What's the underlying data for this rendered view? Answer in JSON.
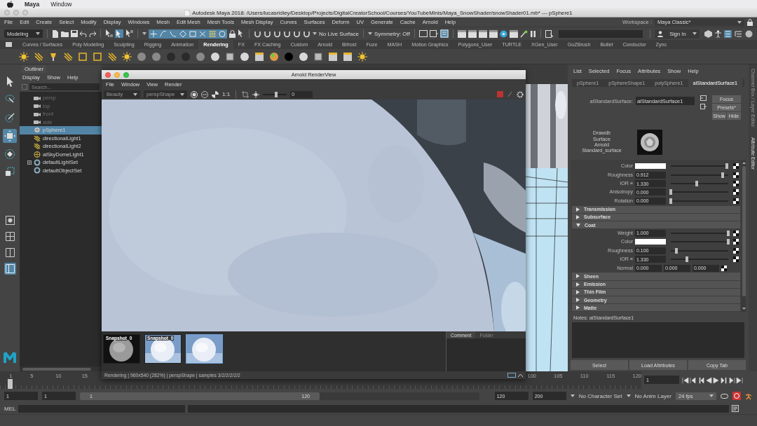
{
  "mac_menubar": {
    "app": "Maya",
    "items": [
      "Window"
    ]
  },
  "window": {
    "title": "Autodesk Maya 2018: /Users/lucasridley/Desktop/Projects/DigitalCreatorSchool/Courses/YouTubeMinis/Maya_SnowShader/snowShader01.mb*  ---  pSphere1"
  },
  "menu_bar": [
    "File",
    "Edit",
    "Create",
    "Select",
    "Modify",
    "Display",
    "Windows",
    "Mesh",
    "Edit Mesh",
    "Mesh Tools",
    "Mesh Display",
    "Curves",
    "Surfaces",
    "Deform",
    "UV",
    "Generate",
    "Cache",
    "Arnold",
    "Help"
  ],
  "workspace": {
    "label": "Workspace :",
    "value": "Maya Classic*"
  },
  "status_line": {
    "menu_set": "Modeling",
    "live_surface": "No Live Surface",
    "symmetry": "Symmetry: Off",
    "sign_in": "Sign In"
  },
  "shelf_tabs": [
    {
      "label": "Curves / Surfaces",
      "selected": false
    },
    {
      "label": "Poly Modeling",
      "selected": false
    },
    {
      "label": "Sculpting",
      "selected": false
    },
    {
      "label": "Rigging",
      "selected": false
    },
    {
      "label": "Animation",
      "selected": false
    },
    {
      "label": "Rendering",
      "selected": true
    },
    {
      "label": "FX",
      "selected": false
    },
    {
      "label": "FX Caching",
      "selected": false
    },
    {
      "label": "Custom",
      "selected": false
    },
    {
      "label": "Arnold",
      "selected": false
    },
    {
      "label": "Bifrost",
      "selected": false
    },
    {
      "label": "Fuze",
      "selected": false
    },
    {
      "label": "MASH",
      "selected": false
    },
    {
      "label": "Motion Graphics",
      "selected": false
    },
    {
      "label": "Polygons_User",
      "selected": false
    },
    {
      "label": "TURTLE",
      "selected": false
    },
    {
      "label": "XGen_User",
      "selected": false
    },
    {
      "label": "GoZBrush",
      "selected": false
    },
    {
      "label": "Bullet",
      "selected": false
    },
    {
      "label": "Conductor",
      "selected": false
    },
    {
      "label": "Zync",
      "selected": false
    }
  ],
  "outliner": {
    "title": "Outliner",
    "menus": [
      "Display",
      "Show",
      "Help"
    ],
    "search": {
      "placeholder": "Search..."
    },
    "items": [
      {
        "label": "persp",
        "kind": "camera",
        "dimmed": true,
        "expander": false,
        "selected": false
      },
      {
        "label": "top",
        "kind": "camera",
        "dimmed": true,
        "expander": false,
        "selected": false
      },
      {
        "label": "front",
        "kind": "camera",
        "dimmed": true,
        "expander": false,
        "selected": false
      },
      {
        "label": "side",
        "kind": "camera",
        "dimmed": true,
        "expander": false,
        "selected": false
      },
      {
        "label": "pSphere1",
        "kind": "mesh",
        "dimmed": false,
        "expander": false,
        "selected": true
      },
      {
        "label": "directionalLight1",
        "kind": "light",
        "dimmed": false,
        "expander": false,
        "selected": false
      },
      {
        "label": "directionalLight2",
        "kind": "light",
        "dimmed": false,
        "expander": false,
        "selected": false
      },
      {
        "label": "aiSkyDomeLight1",
        "kind": "dome",
        "dimmed": false,
        "expander": false,
        "selected": false
      },
      {
        "label": "defaultLightSet",
        "kind": "set",
        "dimmed": false,
        "expander": true,
        "selected": false
      },
      {
        "label": "defaultObjectSet",
        "kind": "set",
        "dimmed": false,
        "expander": false,
        "selected": false
      }
    ]
  },
  "render_view": {
    "title": "Arnold RenderView",
    "menus": [
      "File",
      "Window",
      "View",
      "Render"
    ],
    "aov": "Beauty",
    "camera": "perspShape",
    "zoom": "1:1",
    "exposure": {
      "value": "0",
      "level": 0.55
    },
    "snapshots": [
      {
        "label": "Snapshot_0",
        "kind": "gray",
        "selected": false
      },
      {
        "label": "Snapshot_0",
        "kind": "snow",
        "selected": false
      },
      {
        "kind": "snow",
        "selected": true
      }
    ],
    "panel_tabs": [
      {
        "label": "Comment",
        "selected": true
      },
      {
        "label": "Folder",
        "selected": false
      }
    ],
    "status": "Rendering | 960x540 (282%) | perspShape  | samples 3/2/2/2/2/2"
  },
  "attribute_editor": {
    "menus": [
      "List",
      "Selected",
      "Focus",
      "Attributes",
      "Show",
      "Help"
    ],
    "tabs": [
      {
        "label": "pSphere1",
        "selected": false
      },
      {
        "label": "pSphereShape1",
        "selected": false
      },
      {
        "label": "polySphere1",
        "selected": false
      },
      {
        "label": "aiStandardSurface1",
        "selected": true
      }
    ],
    "node_label": "aiStandardSurface:",
    "node_name": "aiStandardSurface1",
    "buttons": [
      "Focus",
      "Presets*",
      "Show",
      "Hide"
    ],
    "swatch_label": [
      "Drawdb",
      "Surface",
      "Arnold",
      "Standard_surface"
    ],
    "attributes": [
      {
        "kind": "color",
        "label": "Color",
        "level": 0.98
      },
      {
        "kind": "float",
        "label": "Roughness",
        "value": "0.912",
        "level": 0.9
      },
      {
        "kind": "float",
        "label": "IOR ≡",
        "value": "1.330",
        "level": 0.45
      },
      {
        "kind": "float",
        "label": "Anisotropy",
        "value": "0.000",
        "level": 0
      },
      {
        "kind": "float",
        "label": "Rotation",
        "value": "0.000",
        "level": 0
      }
    ],
    "sections": [
      {
        "label": "Transmission",
        "expanded": false
      },
      {
        "label": "Subsurface",
        "expanded": false
      },
      {
        "label": "Coat",
        "expanded": true,
        "attributes": [
          {
            "kind": "float",
            "label": "Weight",
            "value": "1.000",
            "level": 1
          },
          {
            "kind": "color",
            "label": "Color",
            "level": 1
          },
          {
            "kind": "float",
            "label": "Roughness",
            "value": "0.100",
            "level": 0.1
          },
          {
            "kind": "float",
            "label": "IOR ≡",
            "value": "1.330",
            "level": 0.28
          },
          {
            "kind": "vector",
            "label": "Normal",
            "values": [
              "0.000",
              "0.000",
              "0.000"
            ]
          }
        ]
      },
      {
        "label": "Sheen",
        "expanded": false
      },
      {
        "label": "Emission",
        "expanded": false
      },
      {
        "label": "Thin Film",
        "expanded": false
      },
      {
        "label": "Geometry",
        "expanded": false
      },
      {
        "label": "Matte",
        "expanded": false
      }
    ],
    "notes": "Notes:  aiStandardSurface1",
    "bottom_buttons": [
      "Select",
      "Load Attributes",
      "Copy Tab"
    ]
  },
  "side_tabs": [
    {
      "label": "Channel Box / Layer Editor",
      "selected": false
    },
    {
      "label": "Attribute Editor",
      "selected": true
    }
  ],
  "time_slider": {
    "ticks": [
      "1",
      "5",
      "10",
      "15",
      "100",
      "105",
      "110",
      "115",
      "120"
    ],
    "current_frame": "1",
    "level": 0
  },
  "range_slider": {
    "level": 0.6,
    "start": "1",
    "playback_start": "1",
    "slider_start": "1",
    "slider_end": "120",
    "playback_end": "120",
    "end": "200",
    "character_set": "No Character Set",
    "anim_layer": "No Anim Layer",
    "fps": "24 fps"
  },
  "command_line": {
    "language": "MEL"
  }
}
